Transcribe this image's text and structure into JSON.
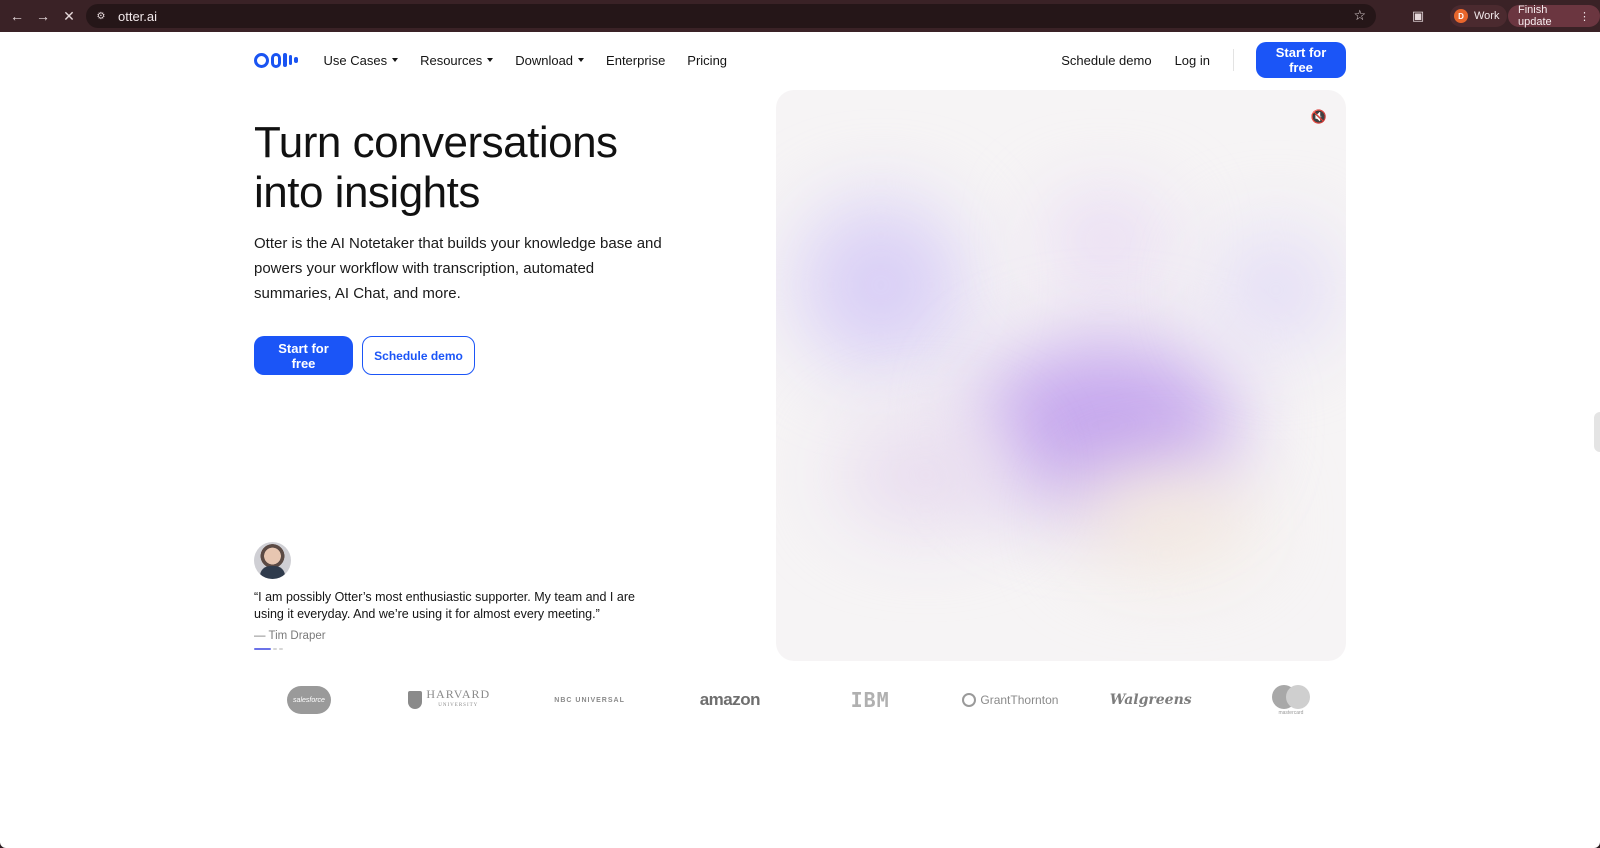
{
  "browser": {
    "url": "otter.ai",
    "profile_label": "Work",
    "profile_initial": "D",
    "finish_update_label": "Finish update"
  },
  "nav": {
    "items": [
      {
        "label": "Use Cases",
        "dropdown": true
      },
      {
        "label": "Resources",
        "dropdown": true
      },
      {
        "label": "Download",
        "dropdown": true
      },
      {
        "label": "Enterprise",
        "dropdown": false
      },
      {
        "label": "Pricing",
        "dropdown": false
      }
    ],
    "schedule_demo": "Schedule demo",
    "log_in": "Log in",
    "start_free": "Start for free"
  },
  "hero": {
    "title_line1": "Turn conversations",
    "title_line2": "into insights",
    "subtitle": "Otter is the AI Notetaker that builds your knowledge base and powers your workflow with transcription, automated summaries, AI Chat, and more.",
    "cta_primary": "Start for free",
    "cta_secondary": "Schedule demo"
  },
  "testimonial": {
    "quote": "“I am possibly Otter’s most enthusiastic supporter. My team and I are using it everyday. And we’re using it for almost every meeting.”",
    "author": "— Tim Draper"
  },
  "logos": {
    "salesforce": "salesforce",
    "harvard": "HARVARD",
    "harvard_sub": "UNIVERSITY",
    "nbc": "NBC UNIVERSAL",
    "amazon": "amazon",
    "ibm": "IBM",
    "grantthornton": "GrantThornton",
    "walgreens": "Walgreens",
    "mastercard": "mastercard"
  },
  "colors": {
    "brand_blue": "#1b55f7",
    "chrome_bg": "#3a2226"
  }
}
